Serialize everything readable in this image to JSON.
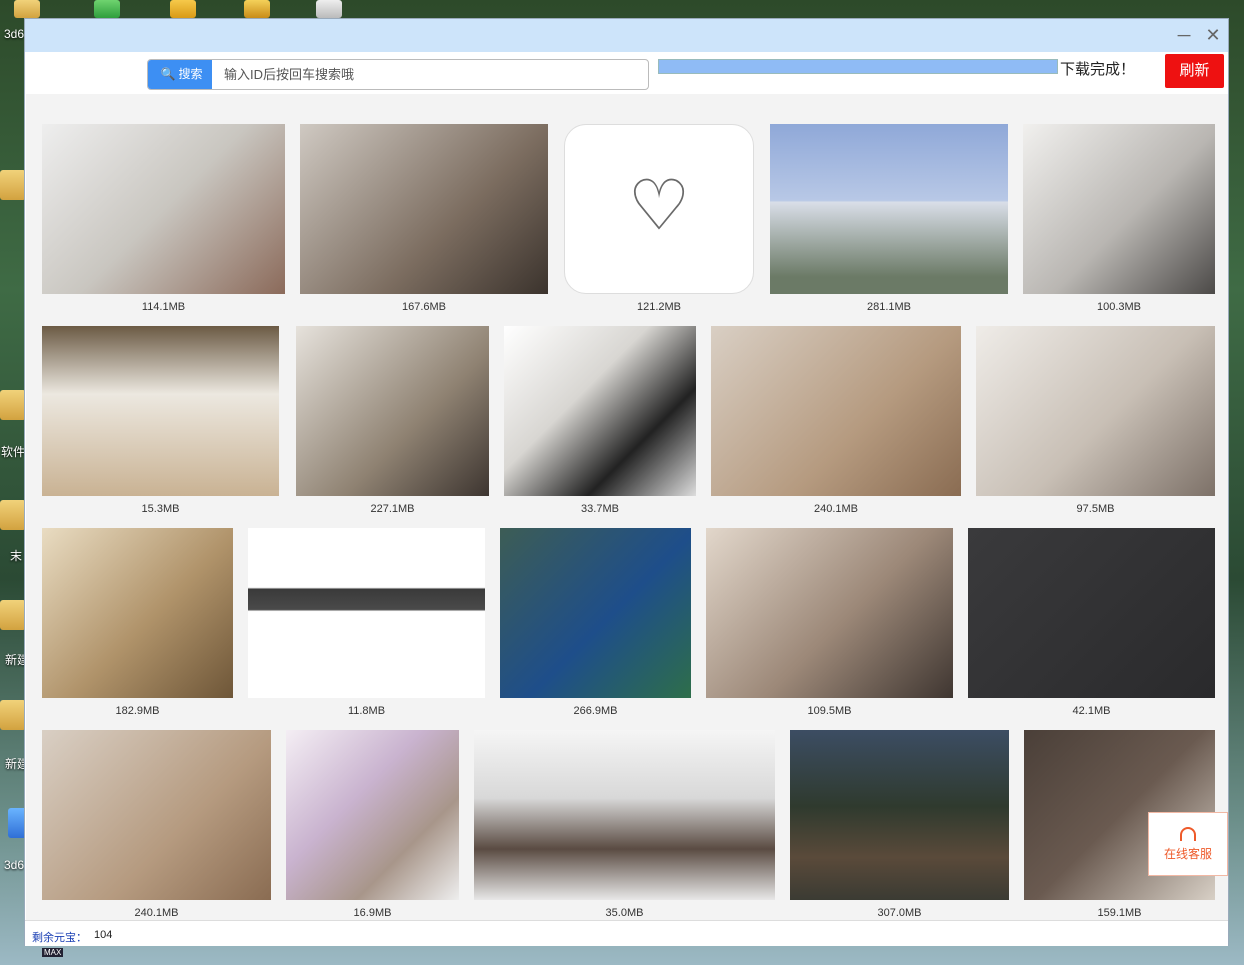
{
  "search": {
    "button_label": "搜索",
    "placeholder": "输入ID后按回车搜索哦"
  },
  "progress": {
    "value": 100,
    "status": "下载完成！"
  },
  "refresh_label": "刷新",
  "items": [
    {
      "size": "114.1MB",
      "kind": "bunkbed"
    },
    {
      "size": "167.6MB",
      "kind": "living"
    },
    {
      "size": "121.2MB",
      "kind": "placeholder"
    },
    {
      "size": "281.1MB",
      "kind": "building"
    },
    {
      "size": "100.3MB",
      "kind": "living2"
    },
    {
      "size": "15.3MB",
      "kind": "cafeteria"
    },
    {
      "size": "227.1MB",
      "kind": "living3"
    },
    {
      "size": "33.7MB",
      "kind": "chairs"
    },
    {
      "size": "240.1MB",
      "kind": "armchair"
    },
    {
      "size": "97.5MB",
      "kind": "living4"
    },
    {
      "size": "182.9MB",
      "kind": "classic"
    },
    {
      "size": "11.8MB",
      "kind": "pingpong"
    },
    {
      "size": "266.9MB",
      "kind": "restaurant"
    },
    {
      "size": "109.5MB",
      "kind": "bedroom"
    },
    {
      "size": "42.1MB",
      "kind": "wine"
    },
    {
      "size": "240.1MB",
      "kind": "armchair"
    },
    {
      "size": "16.9MB",
      "kind": "blinds"
    },
    {
      "size": "35.0MB",
      "kind": "bed"
    },
    {
      "size": "307.0MB",
      "kind": "house"
    },
    {
      "size": "159.1MB",
      "kind": "sofa"
    }
  ],
  "status": {
    "label": "剩余元宝：",
    "value": "104"
  },
  "support_label": "在线客服",
  "desktop": {
    "l1": "3d6",
    "l2": "软件",
    "l3": "末",
    "l4": "新建",
    "l5": "新建",
    "l6": "3d6",
    "max_label": "MAX"
  }
}
